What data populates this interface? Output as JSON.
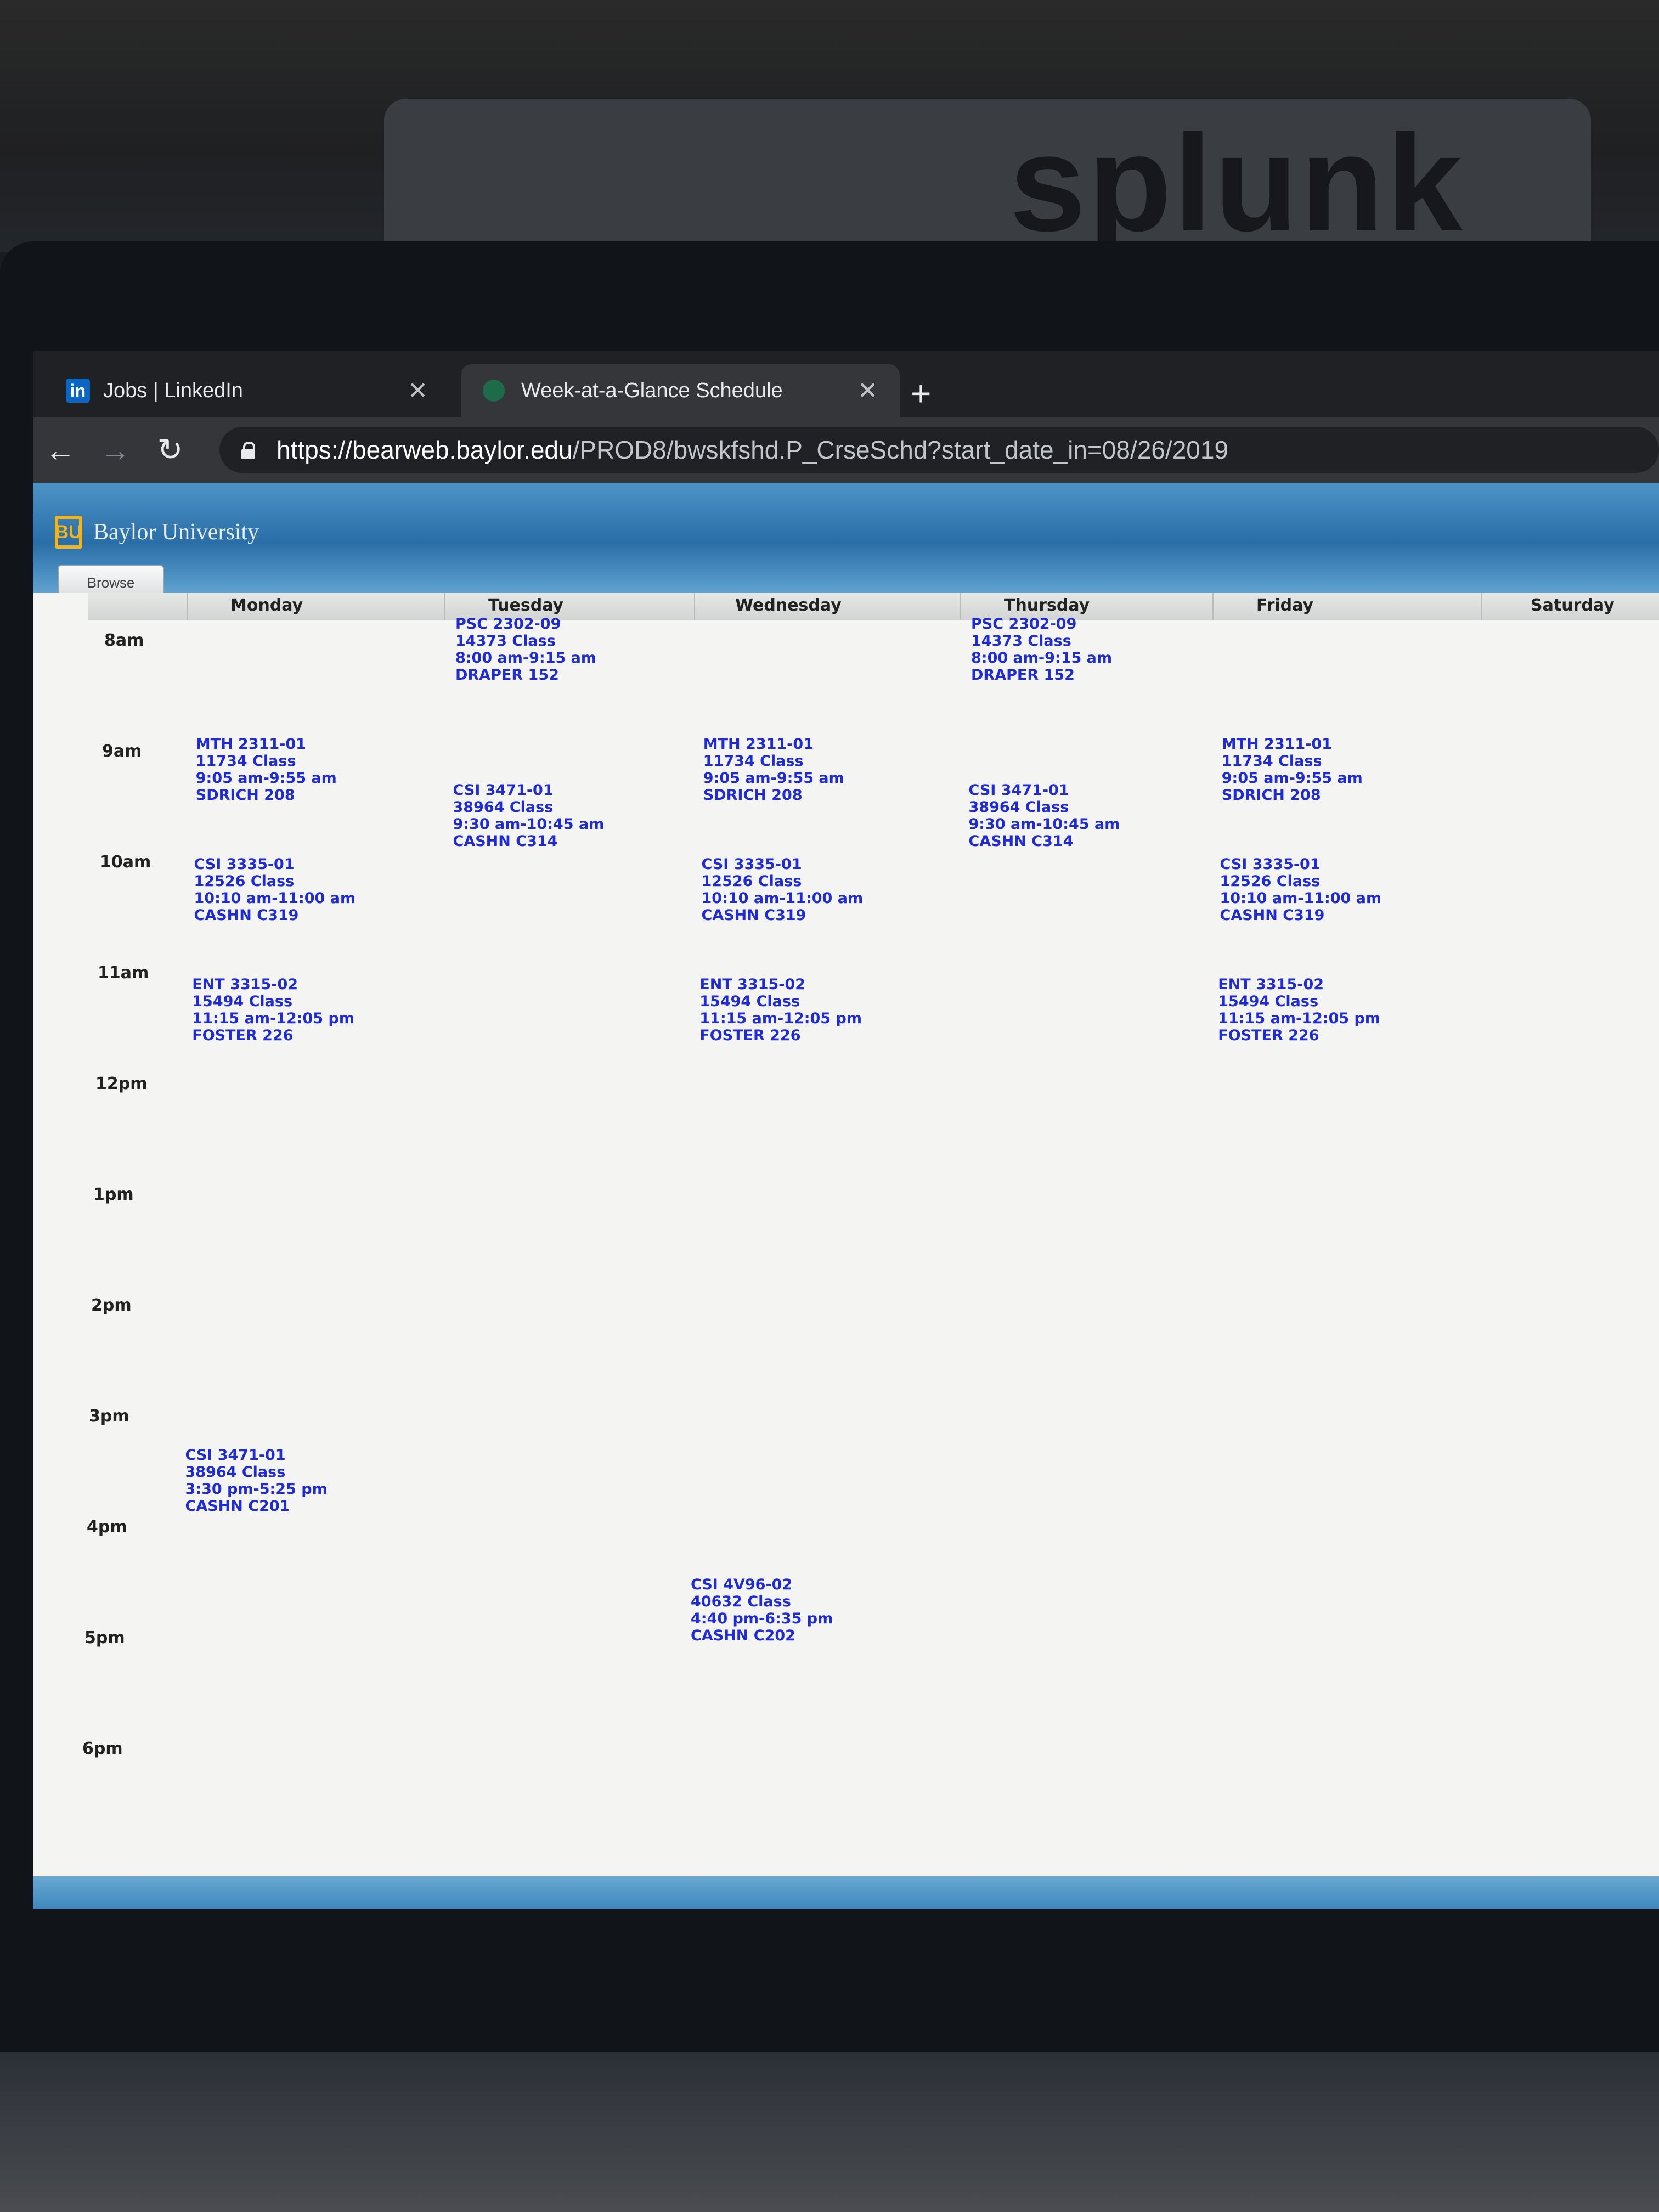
{
  "background": {
    "sign_text": "splunk"
  },
  "tabs": [
    {
      "label": "Jobs | LinkedIn",
      "icon": "linkedin-icon",
      "active": false
    },
    {
      "label": "Week-at-a-Glance Schedule",
      "icon": "globe-icon",
      "active": true
    }
  ],
  "toolbar": {
    "url_host": "https://bearweb.baylor.edu",
    "url_path": "/PROD8/bwskfshd.P_CrseSchd?start_date_in=08/26/2019"
  },
  "header": {
    "university": "Baylor University",
    "logo_text": "BU",
    "browse_label": "Browse"
  },
  "days": [
    "Monday",
    "Tuesday",
    "Wednesday",
    "Thursday",
    "Friday",
    "Saturday"
  ],
  "times": [
    "8am",
    "9am",
    "10am",
    "11am",
    "12pm",
    "1pm",
    "2pm",
    "3pm",
    "4pm",
    "5pm",
    "6pm"
  ],
  "classes": [
    {
      "course": "PSC 2302-09",
      "crn": "14373 Class",
      "time": "8:00 am-9:15 am",
      "room": "DRAPER 152",
      "day": "Tuesday"
    },
    {
      "course": "PSC 2302-09",
      "crn": "14373 Class",
      "time": "8:00 am-9:15 am",
      "room": "DRAPER 152",
      "day": "Thursday"
    },
    {
      "course": "MTH 2311-01",
      "crn": "11734 Class",
      "time": "9:05 am-9:55 am",
      "room": "SDRICH 208",
      "day": "Monday"
    },
    {
      "course": "MTH 2311-01",
      "crn": "11734 Class",
      "time": "9:05 am-9:55 am",
      "room": "SDRICH 208",
      "day": "Wednesday"
    },
    {
      "course": "MTH 2311-01",
      "crn": "11734 Class",
      "time": "9:05 am-9:55 am",
      "room": "SDRICH 208",
      "day": "Friday"
    },
    {
      "course": "CSI 3471-01",
      "crn": "38964 Class",
      "time": "9:30 am-10:45 am",
      "room": "CASHN C314",
      "day": "Tuesday"
    },
    {
      "course": "CSI 3471-01",
      "crn": "38964 Class",
      "time": "9:30 am-10:45 am",
      "room": "CASHN C314",
      "day": "Thursday"
    },
    {
      "course": "CSI 3335-01",
      "crn": "12526 Class",
      "time": "10:10 am-11:00 am",
      "room": "CASHN C319",
      "day": "Monday"
    },
    {
      "course": "CSI 3335-01",
      "crn": "12526 Class",
      "time": "10:10 am-11:00 am",
      "room": "CASHN C319",
      "day": "Wednesday"
    },
    {
      "course": "CSI 3335-01",
      "crn": "12526 Class",
      "time": "10:10 am-11:00 am",
      "room": "CASHN C319",
      "day": "Friday"
    },
    {
      "course": "ENT 3315-02",
      "crn": "15494 Class",
      "time": "11:15 am-12:05 pm",
      "room": "FOSTER 226",
      "day": "Monday"
    },
    {
      "course": "ENT 3315-02",
      "crn": "15494 Class",
      "time": "11:15 am-12:05 pm",
      "room": "FOSTER 226",
      "day": "Wednesday"
    },
    {
      "course": "ENT 3315-02",
      "crn": "15494 Class",
      "time": "11:15 am-12:05 pm",
      "room": "FOSTER 226",
      "day": "Friday"
    },
    {
      "course": "CSI 3471-01",
      "crn": "38964 Class",
      "time": "3:30 pm-5:25 pm",
      "room": "CASHN C201",
      "day": "Monday"
    },
    {
      "course": "CSI 4V96-02",
      "crn": "40632 Class",
      "time": "4:40 pm-6:35 pm",
      "room": "CASHN C202",
      "day": "Wednesday"
    }
  ]
}
